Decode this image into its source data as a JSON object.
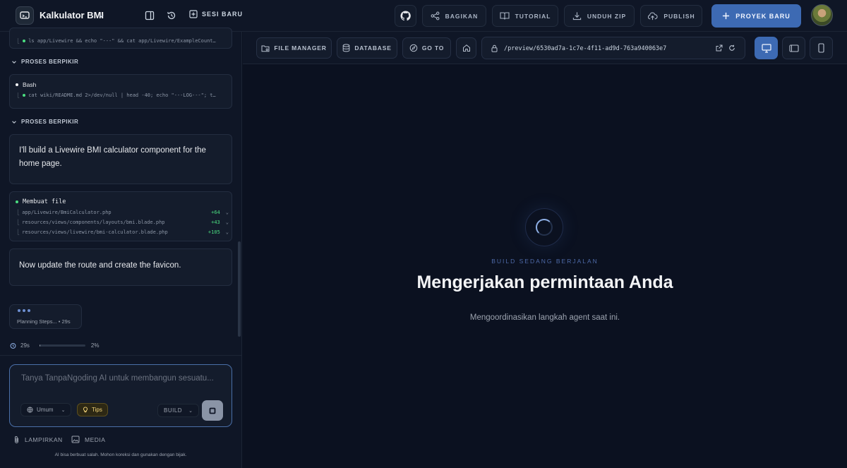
{
  "header": {
    "app_title": "Kalkulator BMI",
    "new_session": "SESI BARU",
    "share": "BAGIKAN",
    "tutorial": "TUTORIAL",
    "download_zip": "UNDUH ZIP",
    "publish": "PUBLISH",
    "new_project": "PROYEK BARU"
  },
  "chat": {
    "top_cmd": "ls app/Livewire && echo \"---\" && cat app/Livewire/ExampleCount…",
    "section1": "PROSES BERPIKIR",
    "bash_title": "Bash",
    "bash_cmd": "cat wiki/README.md 2>/dev/null | head -40; echo \"---LOG---\"; t…",
    "section2": "PROSES BERPIKIR",
    "message1": "I'll build a Livewire BMI calculator component for the home page.",
    "file_title": "Membuat file",
    "files": [
      {
        "path": "app/Livewire/BmiCalculator.php",
        "added": "+64"
      },
      {
        "path": "resources/views/components/layouts/bmi.blade.php",
        "added": "+43"
      },
      {
        "path": "resources/views/livewire/bmi-calculator.blade.php",
        "added": "+105"
      }
    ],
    "message2": "Now update the route and create the favicon.",
    "planning": "Planning Steps... • 29s",
    "elapsed": "29s",
    "progress_label": "2%",
    "progress_value": 0.02
  },
  "composer": {
    "placeholder": "Tanya TanpaNgoding AI untuk membangun sesuatu...",
    "mode": "Umum",
    "tips": "Tips",
    "build": "BUILD",
    "attach": "LAMPIRKAN",
    "media": "MEDIA",
    "disclaimer": "AI bisa berbuat salah. Mohon koreksi dan gunakan dengan bijak."
  },
  "preview": {
    "file_manager": "FILE MANAGER",
    "database": "DATABASE",
    "go_to": "GO TO",
    "url": "/preview/6530ad7a-1c7e-4f11-ad9d-763a940063e7",
    "status": "BUILD SEDANG BERJALAN",
    "heading": "Mengerjakan permintaan Anda",
    "subtext": "Mengoordinasikan langkah agent saat ini."
  },
  "colors": {
    "accent": "#3d6ab3",
    "background": "#0b1120",
    "added_green": "#4ade80"
  }
}
